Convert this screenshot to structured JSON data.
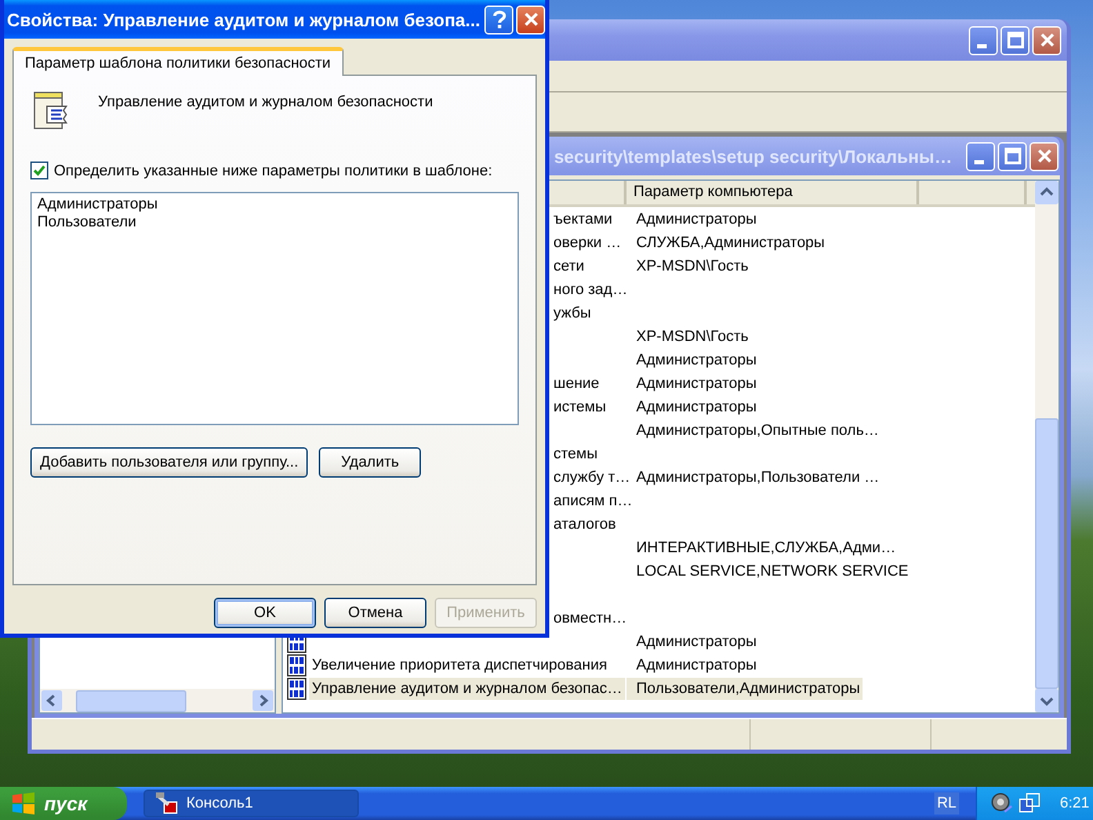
{
  "child_window": {
    "title": "security\\templates\\setup security\\Локальны…",
    "column_header": "Параметр компьютера"
  },
  "rows": [
    {
      "kind": "clipped",
      "name": "ъектами",
      "value": "Администраторы",
      "selected": false
    },
    {
      "kind": "clipped",
      "name": "оверки …",
      "value": "СЛУЖБА,Администраторы",
      "selected": false
    },
    {
      "kind": "clipped",
      "name": "сети",
      "value": "XP-MSDN\\Гость",
      "selected": false
    },
    {
      "kind": "clipped",
      "name": "ного зад…",
      "selected": false
    },
    {
      "kind": "clipped",
      "name": "ужбы",
      "selected": false
    },
    {
      "kind": "clipped",
      "value": "XP-MSDN\\Гость",
      "selected": false
    },
    {
      "kind": "clipped",
      "value": "Администраторы",
      "selected": false
    },
    {
      "kind": "clipped",
      "name": "шение",
      "value": "Администраторы",
      "selected": false
    },
    {
      "kind": "clipped",
      "name": "истемы",
      "value": "Администраторы",
      "selected": false
    },
    {
      "kind": "clipped",
      "value": "Администраторы,Опытные поль…",
      "selected": false
    },
    {
      "kind": "clipped",
      "name": "стемы",
      "selected": false
    },
    {
      "kind": "clipped",
      "name": "службу т…",
      "value": "Администраторы,Пользователи …",
      "selected": false
    },
    {
      "kind": "clipped",
      "name": "аписям п…",
      "selected": false
    },
    {
      "kind": "clipped",
      "name": "аталогов",
      "selected": false
    },
    {
      "kind": "clipped",
      "value": "ИНТЕРАКТИВНЫЕ,СЛУЖБА,Адми…",
      "selected": false
    },
    {
      "kind": "clipped",
      "value": "LOCAL SERVICE,NETWORK SERVICE",
      "selected": false
    },
    {
      "kind": "clipped",
      "selected": false
    },
    {
      "kind": "clipped",
      "name": "овместн…",
      "selected": false
    },
    {
      "kind": "full",
      "value": "Администраторы",
      "selected": false
    },
    {
      "kind": "full",
      "name": "Увеличение приоритета диспетчирования",
      "value": "Администраторы",
      "selected": false
    },
    {
      "kind": "full",
      "name": "Управление аудитом и журналом безопас…",
      "value": "Пользователи,Администраторы",
      "selected": true
    }
  ],
  "dialog": {
    "title": "Свойства: Управление аудитом и журналом безопа...",
    "tabs": [
      {
        "label": "Параметр шаблона политики безопасности",
        "selected": true
      }
    ],
    "policy_title": "Управление аудитом и журналом безопасности",
    "define_checkbox": {
      "label": "Определить указанные ниже параметры политики в шаблоне:",
      "checked": true
    },
    "members": [
      "Администраторы",
      "Пользователи"
    ],
    "add_button": "Добавить пользователя или группу...",
    "remove_button": "Удалить",
    "buttons": [
      {
        "label": "OK",
        "kind": "default"
      },
      {
        "label": "Отмена",
        "kind": "normal"
      },
      {
        "label": "Применить",
        "kind": "disabled"
      }
    ]
  },
  "taskbar": {
    "start": "пуск",
    "tasks": [
      {
        "label": "Консоль1",
        "selected": true
      }
    ],
    "language": "RL",
    "clock": "6:21"
  }
}
